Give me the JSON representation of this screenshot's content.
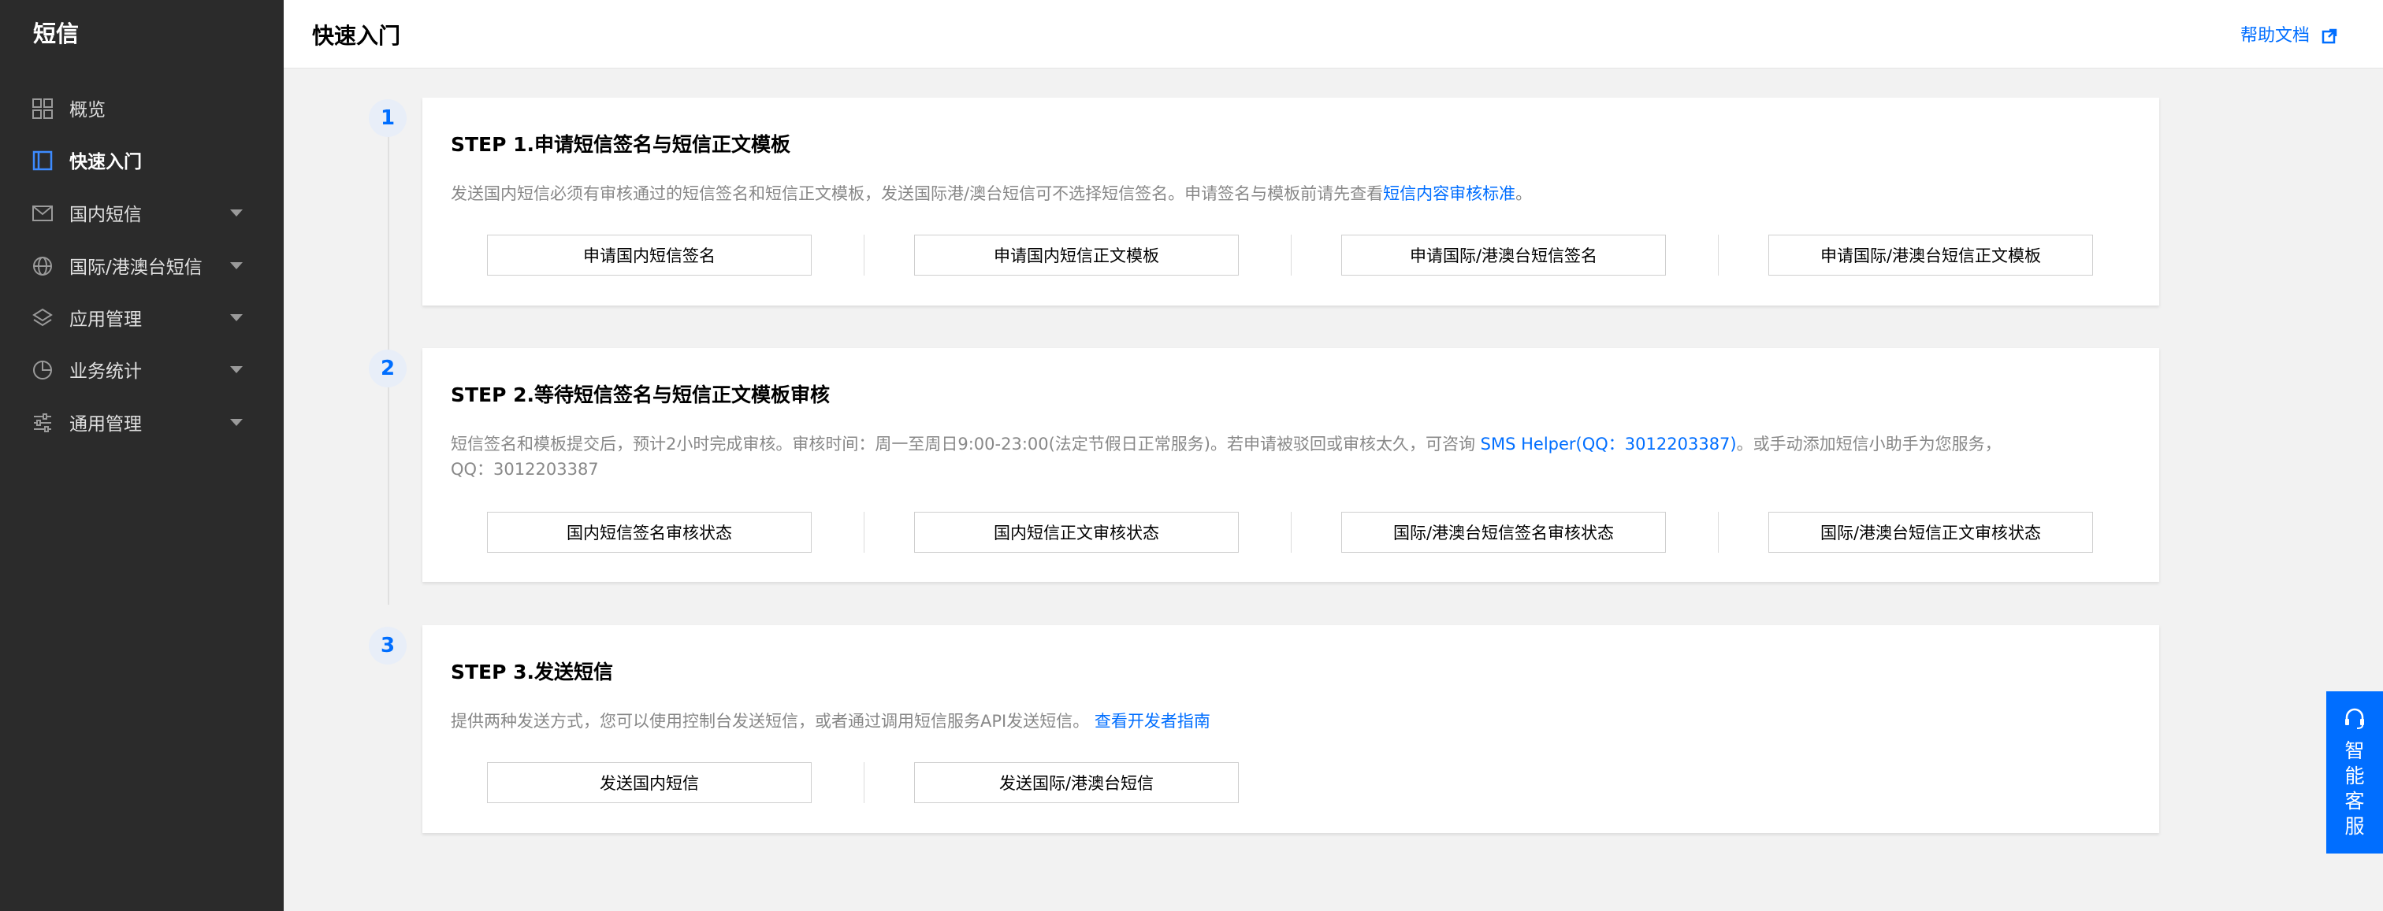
{
  "sidebar": {
    "title": "短信",
    "items": [
      {
        "label": "概览",
        "icon": "grid-icon"
      },
      {
        "label": "快速入门",
        "icon": "book-icon",
        "active": true
      },
      {
        "label": "国内短信",
        "icon": "mail-icon"
      },
      {
        "label": "国际/港澳台短信",
        "icon": "globe-icon"
      },
      {
        "label": "应用管理",
        "icon": "layers-icon"
      },
      {
        "label": "业务统计",
        "icon": "pie-chart-icon"
      },
      {
        "label": "通用管理",
        "icon": "sliders-icon"
      }
    ]
  },
  "header": {
    "title": "快速入门",
    "help_label": "帮助文档"
  },
  "steps": [
    {
      "number": "1",
      "title": "STEP 1.申请短信签名与短信正文模板",
      "desc_text": "发送国内短信必须有审核通过的短信签名和短信正文模板，发送国际港/澳台短信可不选择短信签名。申请签名与模板前请先查看",
      "desc_link": "短信内容审核标准",
      "desc_tail": "。",
      "buttons": [
        "申请国内短信签名",
        "申请国内短信正文模板",
        "申请国际/港澳台短信签名",
        "申请国际/港澳台短信正文模板"
      ]
    },
    {
      "number": "2",
      "title": "STEP 2.等待短信签名与短信正文模板审核",
      "desc_text": "短信签名和模板提交后，预计2小时完成审核。审核时间：周一至周日9:00-23:00(法定节假日正常服务)。若申请被驳回或审核太久，可咨询 ",
      "desc_link": "SMS Helper(QQ：3012203387)",
      "desc_tail": "。或手动添加短信小助手为您服务，QQ：3012203387",
      "buttons": [
        "国内短信签名审核状态",
        "国内短信正文审核状态",
        "国际/港澳台短信签名审核状态",
        "国际/港澳台短信正文审核状态"
      ]
    },
    {
      "number": "3",
      "title": "STEP 3.发送短信",
      "desc_text": "提供两种发送方式，您可以使用控制台发送短信，或者通过调用短信服务API发送短信。 ",
      "desc_link": "查看开发者指南",
      "desc_tail": "",
      "buttons": [
        "发送国内短信",
        "发送国际/港澳台短信"
      ]
    }
  ],
  "smart_service": {
    "label": "智能客服",
    "icon": "headset-icon"
  },
  "colors": {
    "sidebar_bg": "#2b2b2b",
    "accent": "#006eff",
    "page_bg": "#f2f2f2"
  }
}
